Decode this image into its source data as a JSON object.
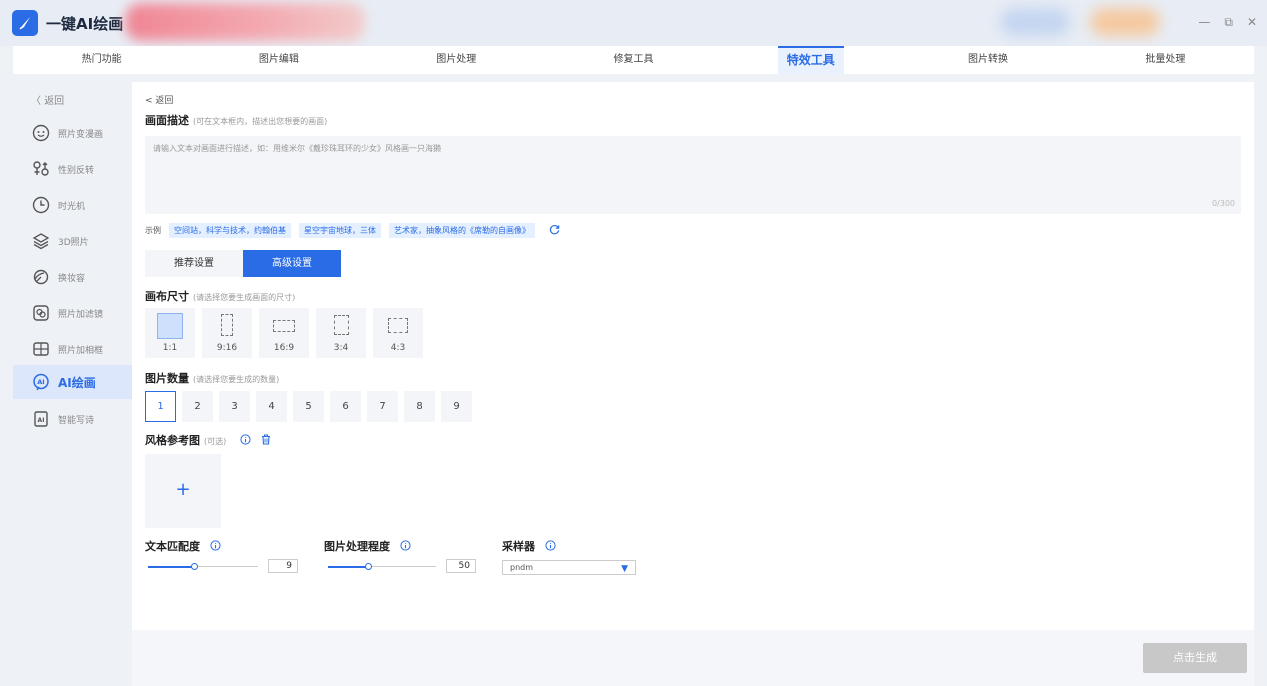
{
  "app": {
    "title": "一键AI绘画"
  },
  "window_controls": {
    "minimize": "—",
    "restore": "⧉",
    "close": "✕"
  },
  "topnav": [
    {
      "label": "热门功能"
    },
    {
      "label": "图片编辑"
    },
    {
      "label": "图片处理"
    },
    {
      "label": "修复工具"
    },
    {
      "label": "特效工具",
      "active": true
    },
    {
      "label": "图片转换"
    },
    {
      "label": "批量处理"
    }
  ],
  "sidebar": {
    "back_label": "返回",
    "items": [
      {
        "label": "照片变漫画",
        "icon": "face-icon"
      },
      {
        "label": "性别反转",
        "icon": "gender-icon"
      },
      {
        "label": "时光机",
        "icon": "clock-icon"
      },
      {
        "label": "3D照片",
        "icon": "layers-icon"
      },
      {
        "label": "换妆容",
        "icon": "makeup-icon"
      },
      {
        "label": "照片加滤镜",
        "icon": "filter-icon"
      },
      {
        "label": "照片加相框",
        "icon": "frame-icon"
      },
      {
        "label": "AI绘画",
        "icon": "ai-paint-icon",
        "active": true
      },
      {
        "label": "智能写诗",
        "icon": "ai-poem-icon"
      }
    ]
  },
  "main": {
    "back_label": "< 返回",
    "description": {
      "title": "画面描述",
      "hint": "(可在文本框内，描述出您想要的画面)",
      "placeholder": "请输入文本对画面进行描述，如：用维米尔《戴珍珠耳环的少女》风格画一只海獭",
      "counter": "0/300"
    },
    "examples": {
      "label": "示例",
      "chips": [
        "空间站，科学与技术，约翰伯基",
        "星空宇宙地球，三体",
        "艺术家，抽象风格的《席勒的自画像》"
      ]
    },
    "settings_tabs": {
      "recommended": "推荐设置",
      "advanced": "高级设置"
    },
    "canvas_size": {
      "title": "画布尺寸",
      "hint": "(请选择您要生成画面的尺寸)",
      "options": [
        "1:1",
        "9:16",
        "16:9",
        "3:4",
        "4:3"
      ],
      "selected": "1:1"
    },
    "image_count": {
      "title": "图片数量",
      "hint": "(请选择您要生成的数量)",
      "options": [
        "1",
        "2",
        "3",
        "4",
        "5",
        "6",
        "7",
        "8",
        "9"
      ],
      "selected": "1"
    },
    "style_ref": {
      "title": "风格参考图",
      "hint": "(可选)",
      "upload_symbol": "+"
    },
    "params": {
      "text_match": {
        "label": "文本匹配度",
        "value": "9",
        "fill": 0.43
      },
      "process_level": {
        "label": "图片处理程度",
        "value": "50",
        "fill": 0.38
      },
      "sampler": {
        "label": "采样器",
        "value": "pndm"
      }
    },
    "generate_button": "点击生成"
  },
  "colors": {
    "accent": "#2a6ce6",
    "disabled": "#c8c8c8"
  }
}
